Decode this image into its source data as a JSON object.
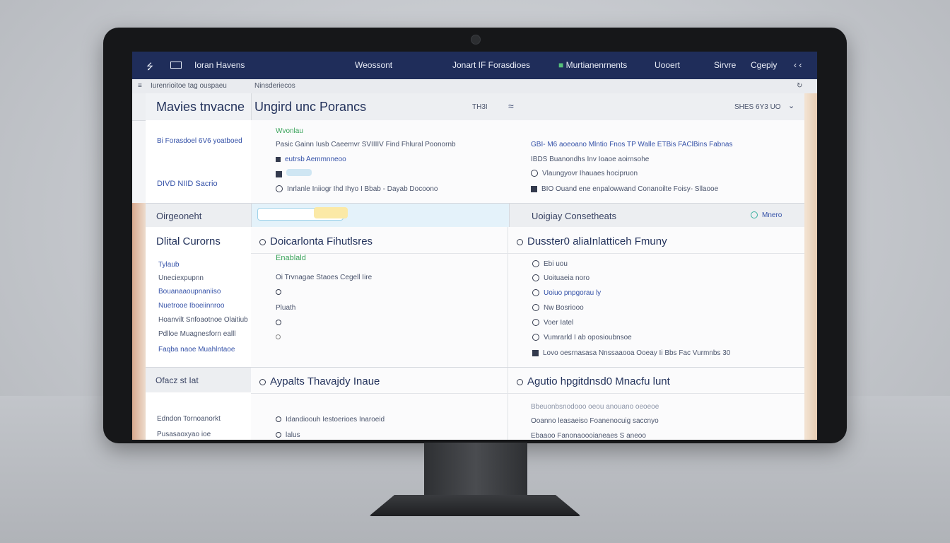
{
  "topbar": {
    "brand": "Ioran Havens",
    "nav": [
      "Weossont",
      "Jonart IF Forasdioes",
      "Murtianenrnents",
      "Uooert",
      "Sirvre",
      "Cgepiy"
    ],
    "brand_color": "#1f2d5a"
  },
  "subbar": {
    "crumb1": "Iurenrioitoe tag ouspaeu",
    "crumb2": "Ninsderiecos"
  },
  "header": {
    "left_title": "Mavies tnvacne",
    "main_title": "Ungird unc Porancs",
    "meta1": "TH3I",
    "meta2": "SHES 6Y3 UO"
  },
  "section1": {
    "side_link1": "Bi Forasdoel 6V6 yoatboed",
    "side_link2": "DIVD NIID Sacrio",
    "tag": "Wvonlau",
    "col1": [
      "Pasic Gainn Iusb Caeemvr SVIIIIV Find Fhlural Poonornb",
      "eutrsb Aemmnneoo",
      "",
      "Inrlanle Iniiogr Ihd Ihyo I Bbab - Dayab Docoono"
    ],
    "col2": [
      "GBI-  M6 aoeoano Mlntio Fnos TP Walle  ETBis FAClBins Fabnas",
      "IBDS  Buanondhs Inv Ioaoe aoirnsohe",
      "Vlaungyovr Ihauaes hocipruon",
      "BIO Ouand ene enpalowwand Conanoilte Foisy- Sllaooe"
    ]
  },
  "section2": {
    "side_header": "Oirgeoneht",
    "right_header": "Uoigiay Consetheats",
    "right_status": "Mnero",
    "side_title": "Dlital Curorns",
    "mid_title": "Doicarlonta Fihutlsres",
    "right_title": "Dusster0 aliaInlatticeh Fmuny",
    "mid_tag": "Enablald",
    "mid_items": [
      "Oi Trvnagae Staoes Cegell Iire",
      "",
      "Pluath",
      "",
      ""
    ],
    "side_items": [
      "Tylaub",
      "Uneciexpupnn",
      "Bouanaaoupnaniiso",
      "Nuetrooe Iboeiinnroo",
      "Hoanvilt Snfoaotnoe Olaitiub",
      "Pdlloe Muagnesforn ealll",
      "Faqba naoe Muahlntaoe"
    ],
    "right_items": [
      "Ebi uou",
      "Uoituaeia noro",
      "Uoiuo pnpgorau ly",
      "Nw Bosriooo",
      "Voer Iatel",
      "Vumrarld I ab oposioubnsoe",
      "Lovo oesrnasasa Nnssaaooa Ooeay Ii  Bbs Fac Vurmnbs 30"
    ]
  },
  "section3": {
    "side_header": "Ofacz st Iat",
    "mid_title": "Aypalts Thavajdy Inaue",
    "right_title": "Agutio hpgitdnsd0 Mnacfu lunt",
    "side_items": [
      "Edndon Tornoanorkt",
      "Pusasaoxyao ioe"
    ],
    "mid_items": [
      "Idandioouh Iestoerioes Inaroeid",
      "lalus"
    ],
    "right_items": [
      "Bbeuonbsnodooo oeou anouano oeoeoe",
      "Ooanno  leasaeiso Foanenocuig saccnyo",
      "Ebaaoo        Fanonaoooianeaes S aneoo"
    ]
  }
}
